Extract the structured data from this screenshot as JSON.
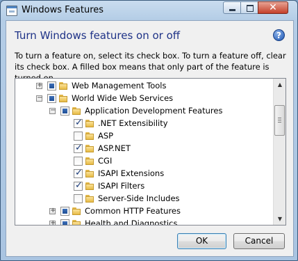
{
  "window": {
    "title": "Windows Features",
    "close_glyph": "✕"
  },
  "dialog": {
    "heading": "Turn Windows features on or off",
    "help_glyph": "?",
    "description": "To turn a feature on, select its check box. To turn a feature off, clear its check box. A filled box means that only part of the feature is turned on."
  },
  "tree": {
    "items": [
      {
        "label": "Web Management Tools",
        "level": 0,
        "expander": "+",
        "state": "partial"
      },
      {
        "label": "World Wide Web Services",
        "level": 0,
        "expander": "−",
        "state": "partial"
      },
      {
        "label": "Application Development Features",
        "level": 1,
        "expander": "−",
        "state": "partial"
      },
      {
        "label": ".NET Extensibility",
        "level": 2,
        "expander": "",
        "state": "checked"
      },
      {
        "label": "ASP",
        "level": 2,
        "expander": "",
        "state": "unchecked"
      },
      {
        "label": "ASP.NET",
        "level": 2,
        "expander": "",
        "state": "checked"
      },
      {
        "label": "CGI",
        "level": 2,
        "expander": "",
        "state": "unchecked"
      },
      {
        "label": "ISAPI Extensions",
        "level": 2,
        "expander": "",
        "state": "checked"
      },
      {
        "label": "ISAPI Filters",
        "level": 2,
        "expander": "",
        "state": "checked"
      },
      {
        "label": "Server-Side Includes",
        "level": 2,
        "expander": "",
        "state": "unchecked"
      },
      {
        "label": "Common HTTP Features",
        "level": 1,
        "expander": "+",
        "state": "partial"
      },
      {
        "label": "Health and Diagnostics",
        "level": 1,
        "expander": "+",
        "state": "partial"
      }
    ]
  },
  "buttons": {
    "ok": "OK",
    "cancel": "Cancel"
  },
  "colors": {
    "heading": "#1e3287",
    "partial_fill": "#1f4f96",
    "ok_focus_border": "#3c7fb1"
  },
  "icons": {
    "app": "windows-features-icon",
    "folder": "folder-icon",
    "help": "help-icon",
    "check": "checkmark-icon"
  }
}
